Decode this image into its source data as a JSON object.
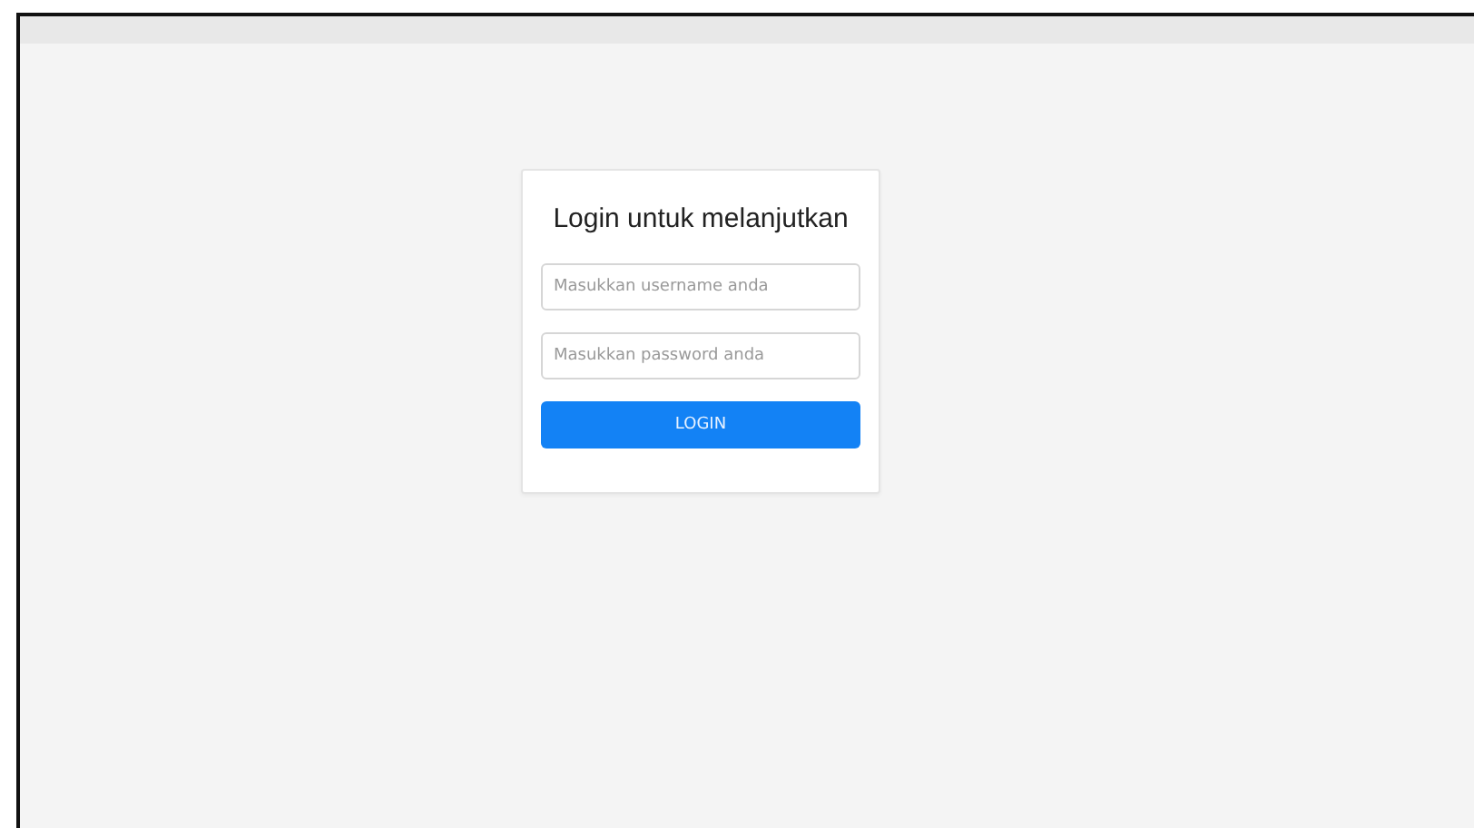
{
  "login": {
    "title": "Login untuk melanjutkan",
    "fields": [
      {
        "placeholder": "Masukkan username anda"
      },
      {
        "placeholder": "Masukkan password anda"
      }
    ],
    "button": "LOGIN"
  }
}
